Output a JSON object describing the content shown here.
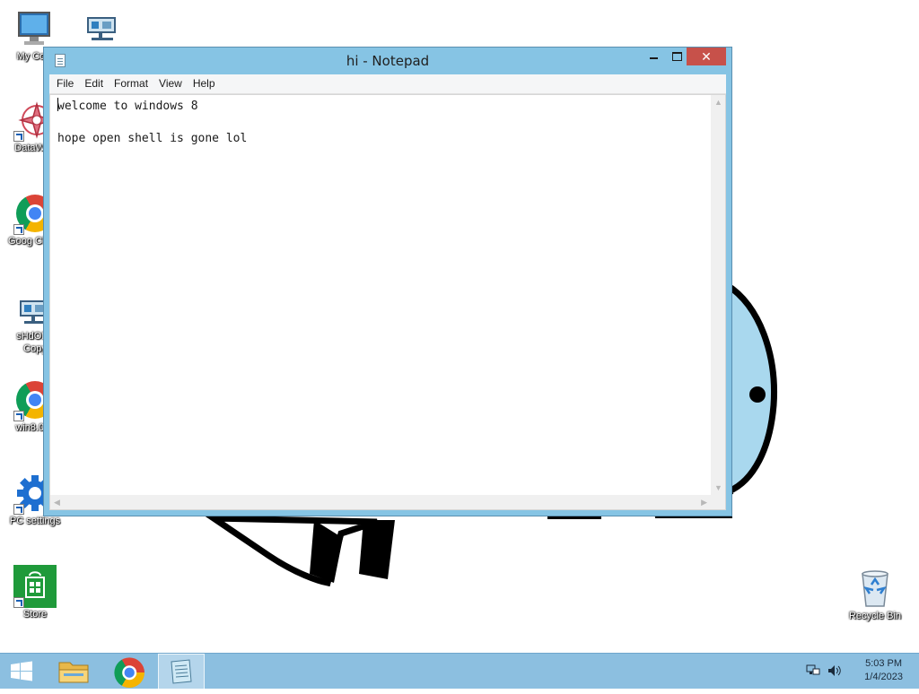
{
  "desktop": {
    "icons": [
      {
        "label": "My Com",
        "icon": "computer-icon"
      },
      {
        "label": "",
        "icon": "network-drive-icon"
      },
      {
        "label": "DataWag",
        "icon": "datawag-icon"
      },
      {
        "label": "Goog Chron",
        "icon": "chrome-icon"
      },
      {
        "label": "sHdOB8 Copy",
        "icon": "network-drive-icon"
      },
      {
        "label": "win8.0vo",
        "icon": "chrome-icon"
      },
      {
        "label": "PC settings",
        "icon": "gear-icon"
      },
      {
        "label": "Store",
        "icon": "store-icon"
      },
      {
        "label": "Recycle Bin",
        "icon": "recycle-bin-icon"
      }
    ]
  },
  "notepad": {
    "title": "hi - Notepad",
    "menu": [
      "File",
      "Edit",
      "Format",
      "View",
      "Help"
    ],
    "close_glyph": "✕",
    "content": "welcome to windows 8\n\nhope open shell is gone lol"
  },
  "taskbar": {
    "time": "5:03 PM",
    "date": "1/4/2023",
    "pinned": [
      "start-icon",
      "file-explorer-icon",
      "chrome-icon",
      "notepad-icon"
    ]
  },
  "colors": {
    "window_frame": "#86c4e4",
    "close_button": "#c7514a",
    "taskbar": "#8cbfe0"
  }
}
